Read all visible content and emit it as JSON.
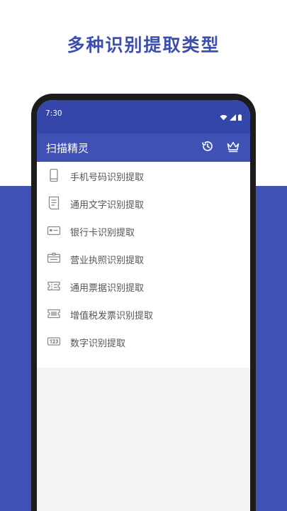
{
  "headline": "多种识别提取类型",
  "status_bar": {
    "time": "7:30"
  },
  "app_bar": {
    "title": "扫描精灵"
  },
  "menu": {
    "items": [
      {
        "label": "手机号码识别提取",
        "icon": "phone-device-icon"
      },
      {
        "label": "通用文字识别提取",
        "icon": "document-icon"
      },
      {
        "label": "银行卡识别提取",
        "icon": "bank-card-icon"
      },
      {
        "label": "营业执照识别提取",
        "icon": "license-icon"
      },
      {
        "label": "通用票据识别提取",
        "icon": "ticket-icon"
      },
      {
        "label": "增值税发票识别提取",
        "icon": "invoice-icon"
      },
      {
        "label": "数字识别提取",
        "icon": "number-icon"
      }
    ]
  },
  "colors": {
    "brand": "#3f51b5",
    "status_bar": "#3446a8",
    "headline": "#3d4fae",
    "item_text": "#555555",
    "icon_gray": "#8a8a8a"
  }
}
